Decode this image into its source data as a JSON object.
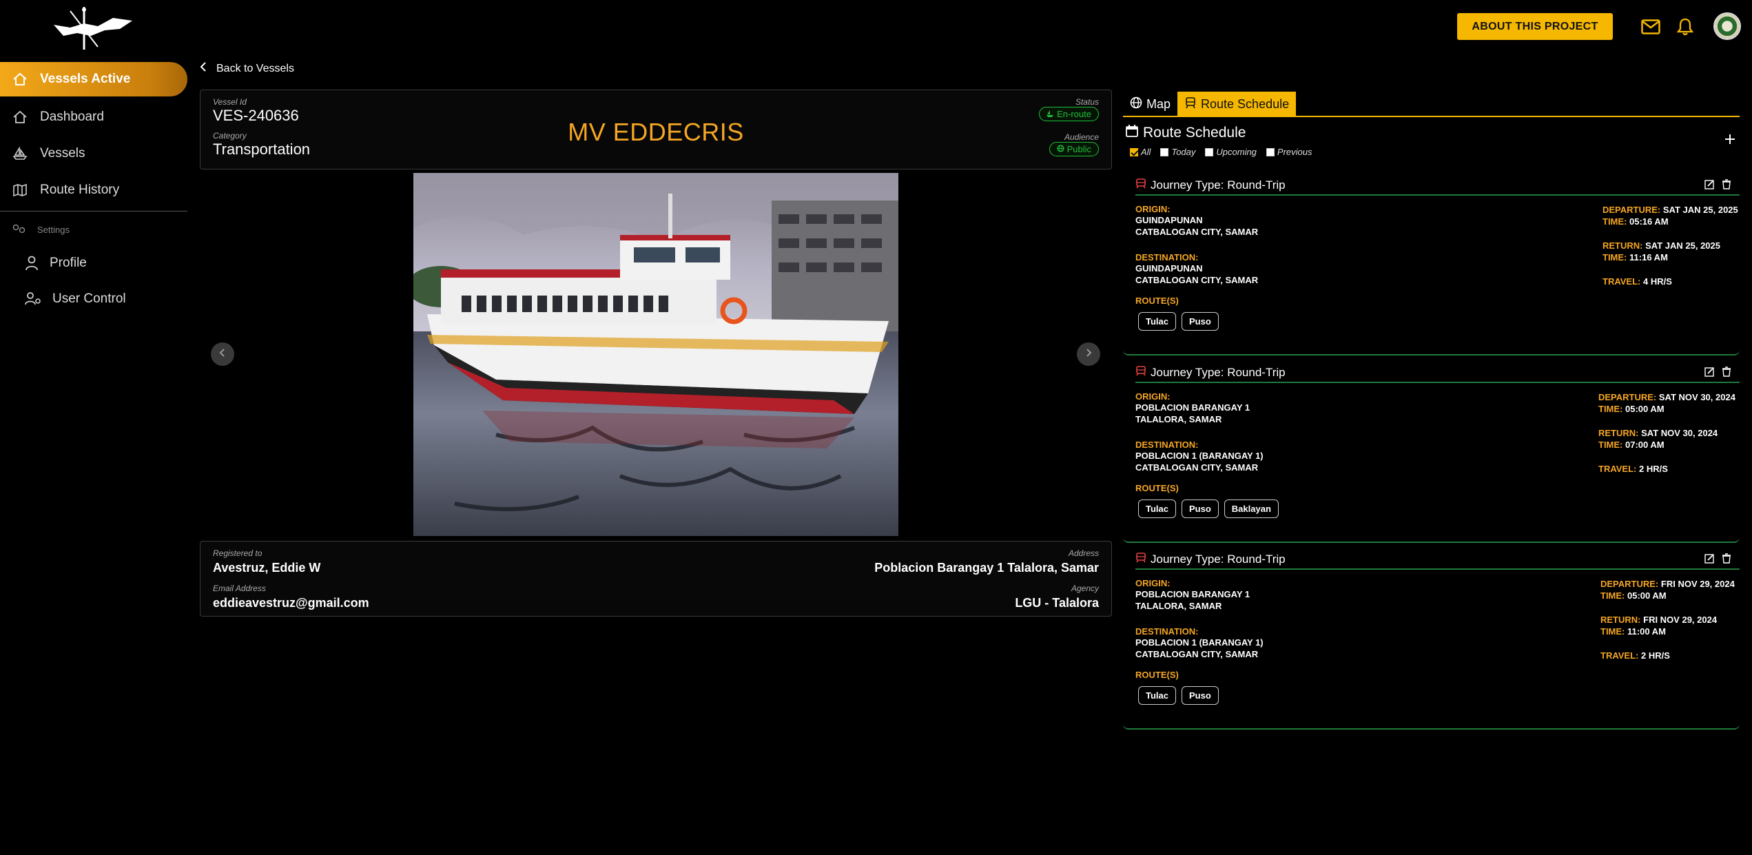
{
  "header": {
    "about_label": "ABOUT THIS PROJECT",
    "icons": [
      "mail-icon",
      "bell-icon",
      "profile-avatar"
    ]
  },
  "sidebar": {
    "items": [
      {
        "label": "Vessels Active",
        "icon": "home-icon",
        "active": true
      },
      {
        "label": "Dashboard",
        "icon": "home-outline-icon"
      },
      {
        "label": "Vessels",
        "icon": "ship-icon"
      },
      {
        "label": "Route History",
        "icon": "map-icon"
      }
    ],
    "settings_label": "Settings",
    "settings_items": [
      {
        "label": "Profile",
        "icon": "person-icon"
      },
      {
        "label": "User Control",
        "icon": "users-gear-icon"
      }
    ]
  },
  "main": {
    "back_label": "Back to Vessels",
    "vessel": {
      "id_label": "Vessel Id",
      "id": "VES-240636",
      "category_label": "Category",
      "category": "Transportation",
      "name": "MV EDDECRIS",
      "status_label": "Status",
      "status": "En-route",
      "audience_label": "Audience",
      "audience": "Public"
    },
    "owner": {
      "registered_label": "Registered to",
      "registered": "Avestruz, Eddie W",
      "email_label": "Email Address",
      "email": "eddieavestruz@gmail.com",
      "address_label": "Address",
      "address": "Poblacion Barangay 1 Talalora, Samar",
      "agency_label": "Agency",
      "agency": "LGU - Talalora"
    }
  },
  "right": {
    "tabs": [
      {
        "label": "Map",
        "icon": "globe-icon",
        "active": false
      },
      {
        "label": "Route Schedule",
        "icon": "bus-icon",
        "active": true
      }
    ],
    "title": "Route Schedule",
    "filters": [
      {
        "label": "All",
        "checked": true
      },
      {
        "label": "Today",
        "checked": false
      },
      {
        "label": "Upcoming",
        "checked": false
      },
      {
        "label": "Previous",
        "checked": false
      }
    ],
    "labels": {
      "origin": "ORIGIN:",
      "destination": "DESTINATION:",
      "routes": "ROUTE(S)",
      "departure": "DEPARTURE:",
      "return": "RETURN:",
      "time": "TIME:",
      "travel": "TRAVEL:"
    },
    "journeys": [
      {
        "type": "Journey Type: Round-Trip",
        "origin1": "GUINDAPUNAN",
        "origin2": "CATBALOGAN CITY, SAMAR",
        "dest1": "GUINDAPUNAN",
        "dest2": "CATBALOGAN CITY, SAMAR",
        "departure": "SAT JAN 25, 2025",
        "dep_time": "05:16 AM",
        "return": "SAT JAN 25, 2025",
        "ret_time": "11:16 AM",
        "travel": "4 HR/S",
        "routes": [
          "Tulac",
          "Puso"
        ]
      },
      {
        "type": "Journey Type: Round-Trip",
        "origin1": "POBLACION BARANGAY 1",
        "origin2": "TALALORA, SAMAR",
        "dest1": "POBLACION 1 (BARANGAY 1)",
        "dest2": "CATBALOGAN CITY, SAMAR",
        "departure": "SAT NOV 30, 2024",
        "dep_time": "05:00 AM",
        "return": "SAT NOV 30, 2024",
        "ret_time": "07:00 AM",
        "travel": "2 HR/S",
        "routes": [
          "Tulac",
          "Puso",
          "Baklayan"
        ]
      },
      {
        "type": "Journey Type: Round-Trip",
        "origin1": "POBLACION BARANGAY 1",
        "origin2": "TALALORA, SAMAR",
        "dest1": "POBLACION 1 (BARANGAY 1)",
        "dest2": "CATBALOGAN CITY, SAMAR",
        "departure": "FRI NOV 29, 2024",
        "dep_time": "05:00 AM",
        "return": "FRI NOV 29, 2024",
        "ret_time": "11:00 AM",
        "travel": "2 HR/S",
        "routes": [
          "Tulac",
          "Puso"
        ]
      }
    ]
  }
}
